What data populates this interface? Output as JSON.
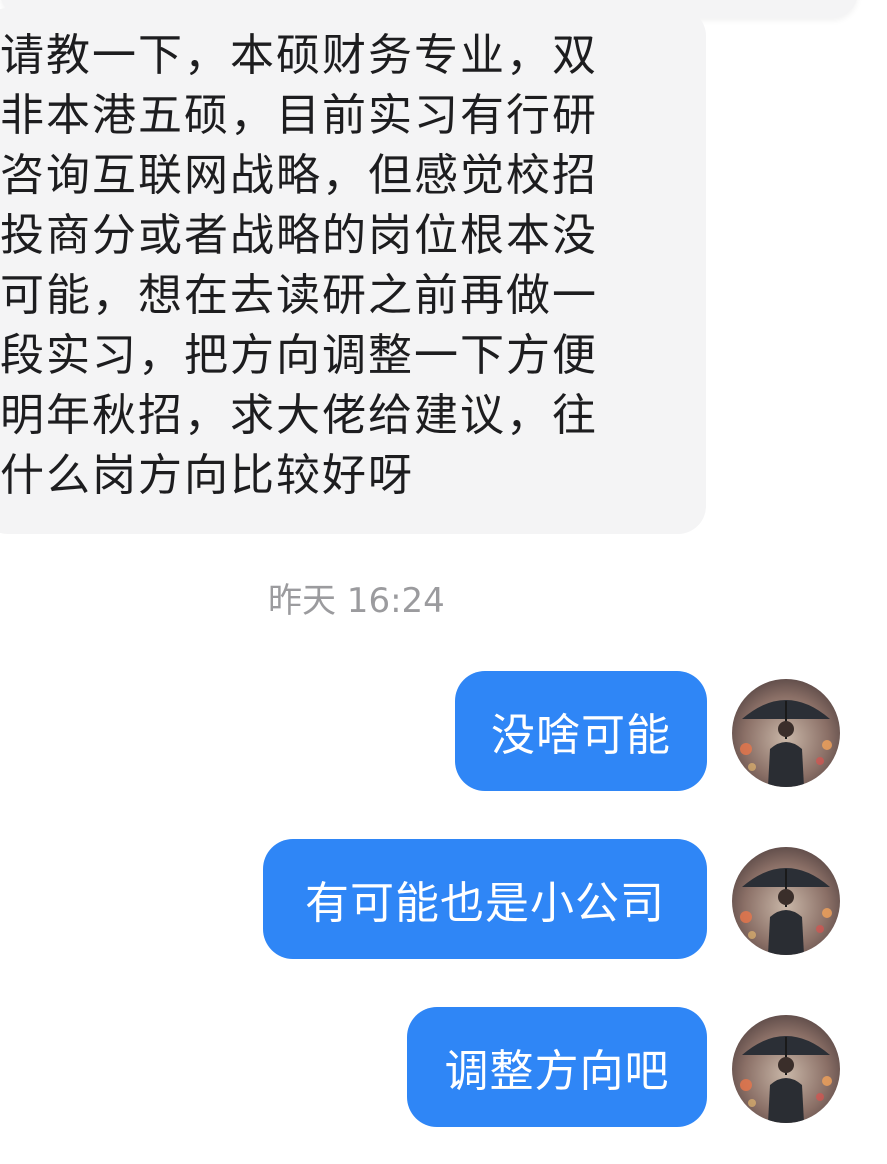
{
  "incoming_message": {
    "text": "请教一下，本硕财务专业，双\n非本港五硕，目前实习有行研\n咨询互联网战略，但感觉校招\n投商分或者战略的岗位根本没\n可能，想在去读研之前再做一\n段实习，把方向调整一下方便\n明年秋招，求大佬给建议，往\n什么岗方向比较好呀"
  },
  "timestamp": "昨天 16:24",
  "outgoing_messages": [
    {
      "text": "没啥可能",
      "avatar_icon": "avatar-man-with-umbrella"
    },
    {
      "text": "有可能也是小公司",
      "avatar_icon": "avatar-man-with-umbrella"
    },
    {
      "text": "调整方向吧",
      "avatar_icon": "avatar-man-with-umbrella"
    }
  ],
  "colors": {
    "incoming_bubble": "#f4f4f5",
    "outgoing_bubble": "#2f86f6",
    "timestamp": "#9b9b9e",
    "text_dark": "#1d1d1f"
  }
}
